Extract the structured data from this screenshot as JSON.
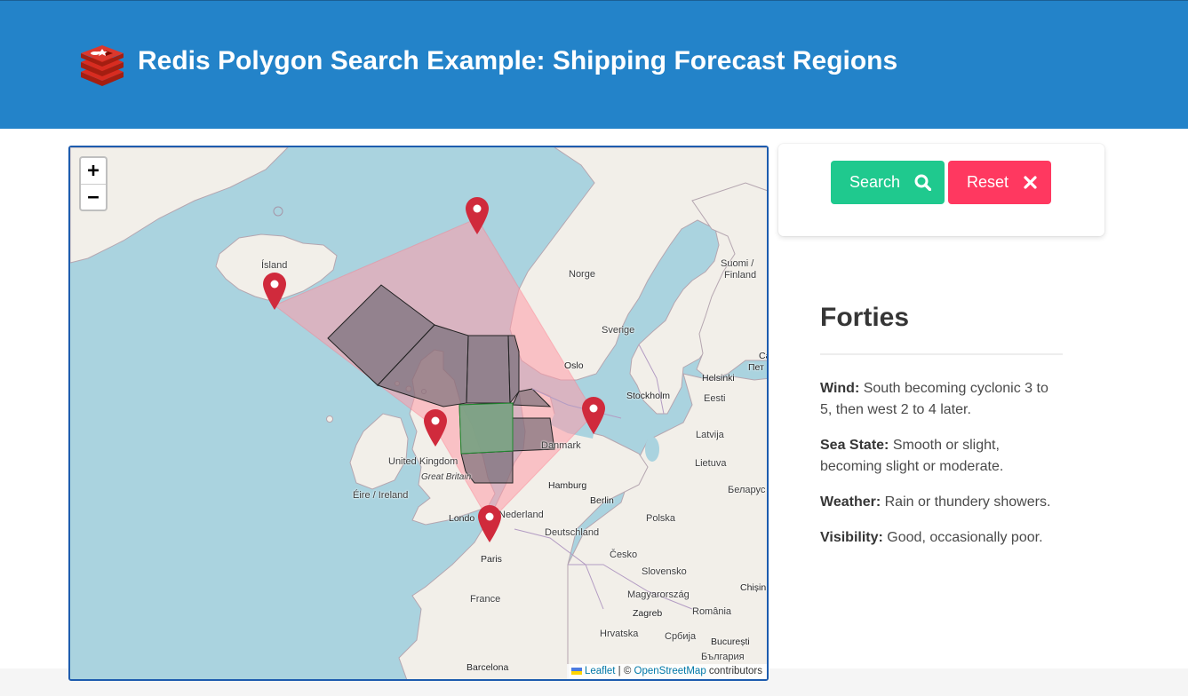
{
  "header": {
    "title": "Redis Polygon Search Example: Shipping Forecast Regions"
  },
  "map": {
    "zoom_in": "+",
    "zoom_out": "−",
    "attribution": {
      "leaflet": "Leaflet",
      "separator": " | © ",
      "osm": "OpenStreetMap",
      "suffix": " contributors"
    },
    "labels": {
      "island": "Ísland",
      "norge": "Norge",
      "suomi": "Suomi /",
      "finland": "Finland",
      "sverige": "Sverige",
      "oslo": "Oslo",
      "helsinki": "Helsinki",
      "stockholm": "Stockholm",
      "eesti": "Eesti",
      "latvija": "Latvija",
      "lietuva": "Lietuva",
      "danmark": "Danmark",
      "belarus": "Беларус",
      "uk": "United Kingdom",
      "gb": "Great Britain",
      "eire": "Éire / Ireland",
      "hamburg": "Hamburg",
      "berlin": "Berlin",
      "polska": "Polska",
      "london": "Londo",
      "nederland": "Nederland",
      "deutschland": "Deutschland",
      "paris": "Paris",
      "cesko": "Česko",
      "slovensko": "Slovensko",
      "magyar": "Magyarország",
      "france": "France",
      "chisin": "Chișin",
      "zagreb": "Zagreb",
      "romania": "România",
      "hrvatska": "Hrvatska",
      "srbija": "Србија",
      "bucuresti": "București",
      "bulgaria": "България",
      "barcelona": "Barcelona",
      "ca": "Ca",
      "pet": "Пет"
    }
  },
  "controls": {
    "search_label": "Search",
    "reset_label": "Reset",
    "search_icon": "search-icon",
    "reset_icon": "close-icon",
    "search_color": "#1fc98e",
    "reset_color": "#ff3860"
  },
  "forecast": {
    "region": "Forties",
    "wind_label": "Wind:",
    "wind": "South becoming cyclonic 3 to 5, then west 2 to 4 later.",
    "sea_label": "Sea State:",
    "sea": "Smooth or slight, becoming slight or moderate.",
    "weather_label": "Weather:",
    "weather": "Rain or thundery showers.",
    "visibility_label": "Visibility:",
    "visibility": "Good, occasionally poor."
  },
  "colors": {
    "header": "#2383c9",
    "marker": "#d02a3c"
  }
}
